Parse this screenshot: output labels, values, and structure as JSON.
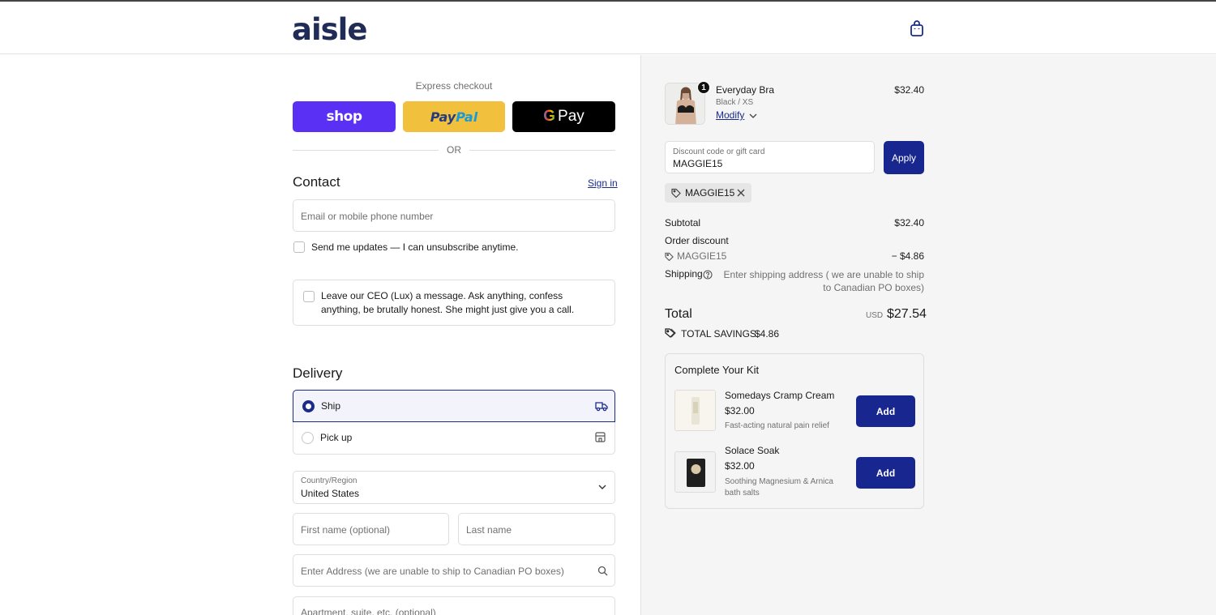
{
  "brand": {
    "logo_text": "aisle"
  },
  "icons": {
    "cart": "shopping-bag-icon",
    "truck": "truck-icon",
    "store": "store-icon",
    "search": "search-icon",
    "chevron": "chevron-down-icon",
    "tag": "tag-icon",
    "close": "close-icon",
    "info": "question-circle-icon"
  },
  "colors": {
    "primary": "#17278f",
    "shop_pay": "#5a31f4",
    "paypal": "#f1c13d",
    "brand": "#202c55"
  },
  "express": {
    "label": "Express checkout",
    "shop_label": "shop",
    "paypal_label_1": "Pay",
    "paypal_label_2": "Pal",
    "gpay_g": "G",
    "gpay_label": "Pay",
    "or_label": "OR"
  },
  "contact": {
    "title": "Contact",
    "sign_in": "Sign in",
    "email_placeholder": "Email or mobile phone number",
    "updates_label": "Send me updates — I can unsubscribe anytime.",
    "ceo_message": "Leave our CEO (Lux) a message. Ask anything, confess anything, be brutally honest. She might just give you a call."
  },
  "delivery": {
    "title": "Delivery",
    "options": [
      {
        "label": "Ship",
        "selected": true
      },
      {
        "label": "Pick up",
        "selected": false
      }
    ],
    "country_label": "Country/Region",
    "country_value": "United States",
    "first_name_placeholder": "First name (optional)",
    "last_name_placeholder": "Last name",
    "address_placeholder": "Enter Address (we are unable to ship to Canadian PO boxes)",
    "apartment_placeholder": "Apartment, suite, etc. (optional)"
  },
  "summary": {
    "item": {
      "name": "Everyday Bra",
      "variant": "Black / XS",
      "modify": "Modify",
      "qty": "1",
      "price": "$32.40"
    },
    "discount_label": "Discount code or gift card",
    "discount_value": "MAGGIE15",
    "apply": "Apply",
    "applied_code": "MAGGIE15",
    "subtotal_label": "Subtotal",
    "subtotal_value": "$32.40",
    "order_discount_label": "Order discount",
    "discount_code": "MAGGIE15",
    "discount_amount": "− $4.86",
    "shipping_label": "Shipping",
    "shipping_value": "Enter shipping address ( we are unable to ship to Canadian PO boxes)",
    "total_label": "Total",
    "currency": "USD",
    "total_value": "$27.54",
    "savings_label": "TOTAL SAVINGS",
    "savings_value": "$4.86"
  },
  "kit": {
    "title": "Complete Your Kit",
    "products": [
      {
        "name": "Somedays Cramp Cream",
        "price": "$32.00",
        "desc": "Fast-acting natural pain relief",
        "add": "Add"
      },
      {
        "name": "Solace Soak",
        "price": "$32.00",
        "desc": "Soothing Magnesium & Arnica bath salts",
        "add": "Add"
      }
    ]
  }
}
